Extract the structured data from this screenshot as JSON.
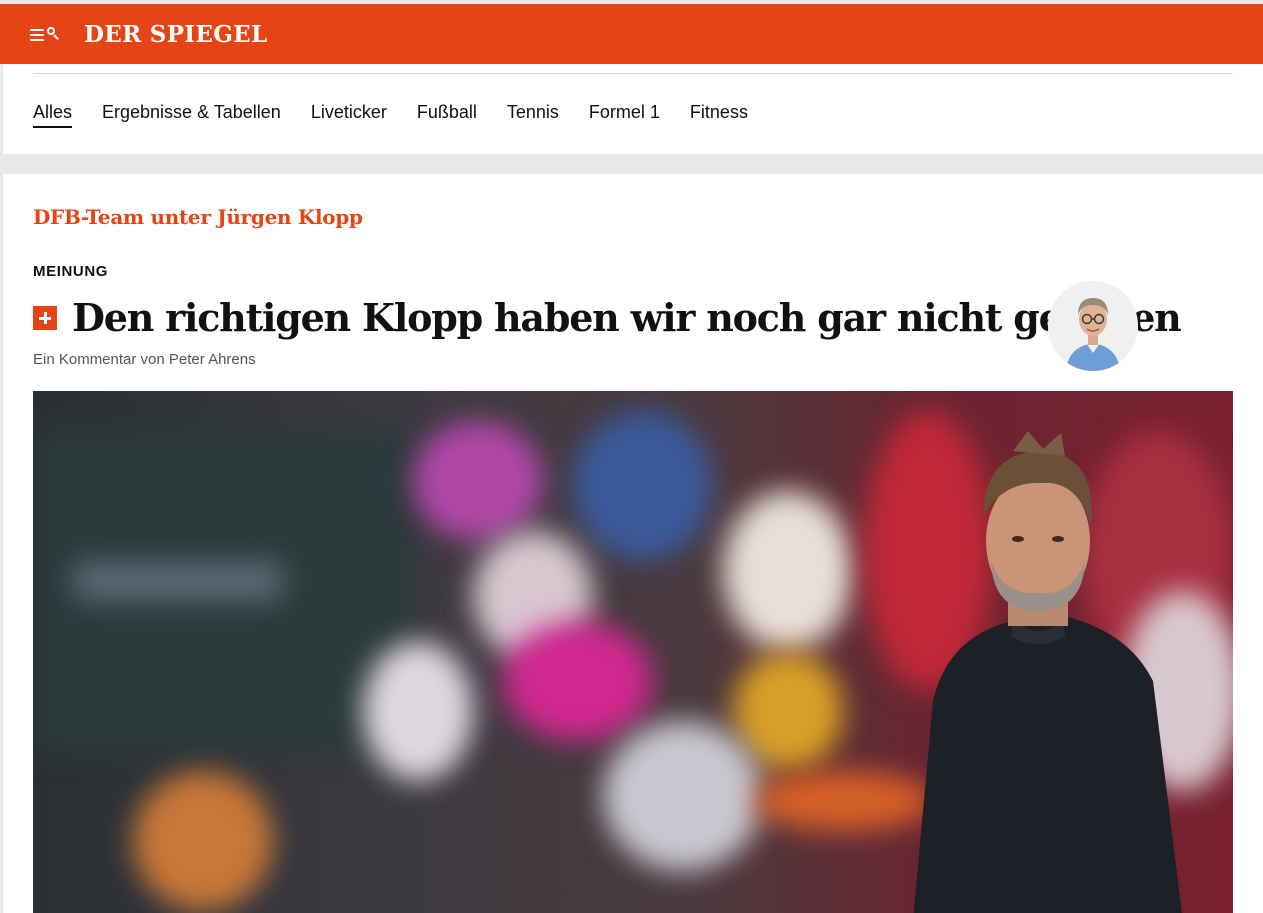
{
  "header": {
    "logo": "DER SPIEGEL",
    "menu_icon": "menu-search-icon",
    "brand_color": "#e64415"
  },
  "nav": {
    "items": [
      {
        "label": "Alles",
        "active": true
      },
      {
        "label": "Ergebnisse & Tabellen",
        "active": false
      },
      {
        "label": "Liveticker",
        "active": false
      },
      {
        "label": "Fußball",
        "active": false
      },
      {
        "label": "Tennis",
        "active": false
      },
      {
        "label": "Formel 1",
        "active": false
      },
      {
        "label": "Fitness",
        "active": false
      }
    ]
  },
  "article": {
    "kicker": "DFB-Team unter Jürgen Klopp",
    "label": "MEINUNG",
    "plus_icon": "spiegel-plus-icon",
    "headline": "Den richtigen Klopp haben wir noch gar nicht gesehen",
    "byline": "Ein Kommentar von Peter Ahrens"
  }
}
